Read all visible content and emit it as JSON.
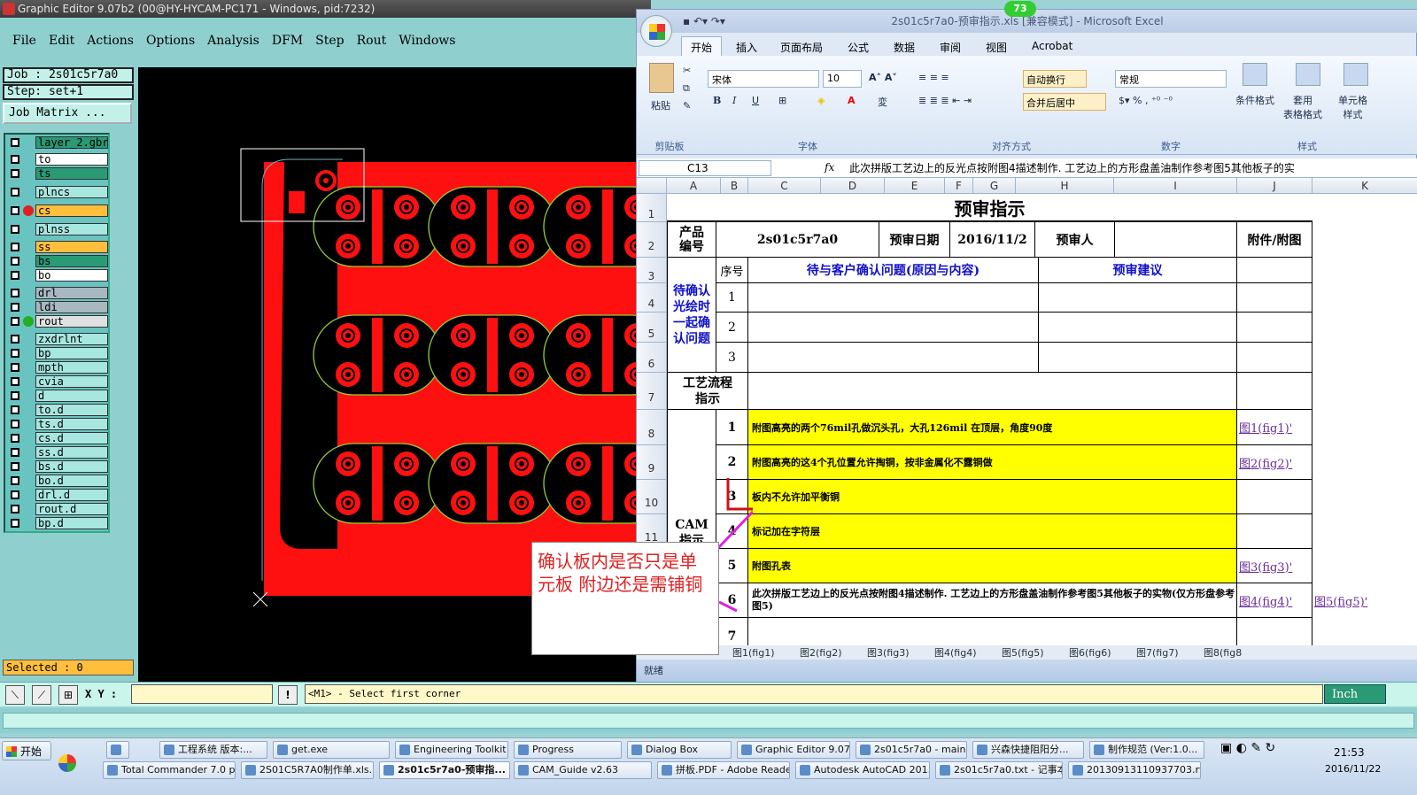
{
  "graphic_editor": {
    "title": "Graphic Editor 9.07b2 (00@HY-HYCAM-PC171 - Windows, pid:7232)",
    "menu": [
      "File",
      "Edit",
      "Actions",
      "Options",
      "Analysis",
      "DFM",
      "Step",
      "Rout",
      "Windows"
    ],
    "job": "Job : 2s01c5r7a0",
    "step": "Step: set+1",
    "job_matrix": "Job Matrix ...",
    "layers": [
      {
        "name": "layer_2.gbr",
        "color": "#2a9a74",
        "dot": ""
      },
      {
        "name": "to",
        "color": "#ffffff",
        "dot": ""
      },
      {
        "name": "ts",
        "color": "#2a9a74",
        "dot": ""
      },
      {
        "name": "plncs",
        "color": "#a8e6e0",
        "dot": ""
      },
      {
        "name": "cs",
        "color": "#ffbf3c",
        "dot": "#e02020"
      },
      {
        "name": "plnss",
        "color": "#a8e6e0",
        "dot": ""
      },
      {
        "name": "ss",
        "color": "#ffbf3c",
        "dot": ""
      },
      {
        "name": "bs",
        "color": "#2a9a74",
        "dot": ""
      },
      {
        "name": "bo",
        "color": "#ffffff",
        "dot": ""
      },
      {
        "name": "drl",
        "color": "#a8b8c0",
        "dot": ""
      },
      {
        "name": "ldi",
        "color": "#a8b8c0",
        "dot": ""
      },
      {
        "name": "rout",
        "color": "#e0e0e0",
        "dot": "#20b020"
      },
      {
        "name": "zxdrlnt",
        "color": "#a8e6e0",
        "dot": ""
      },
      {
        "name": "bp",
        "color": "#a8e6e0",
        "dot": ""
      },
      {
        "name": "mpth",
        "color": "#a8e6e0",
        "dot": ""
      },
      {
        "name": "cvia",
        "color": "#a8e6e0",
        "dot": ""
      },
      {
        "name": "d",
        "color": "#a8e6e0",
        "dot": ""
      },
      {
        "name": "to.d",
        "color": "#a8e6e0",
        "dot": ""
      },
      {
        "name": "ts.d",
        "color": "#a8e6e0",
        "dot": ""
      },
      {
        "name": "cs.d",
        "color": "#a8e6e0",
        "dot": ""
      },
      {
        "name": "ss.d",
        "color": "#a8e6e0",
        "dot": ""
      },
      {
        "name": "bs.d",
        "color": "#a8e6e0",
        "dot": ""
      },
      {
        "name": "bo.d",
        "color": "#a8e6e0",
        "dot": ""
      },
      {
        "name": "drl.d",
        "color": "#a8e6e0",
        "dot": ""
      },
      {
        "name": "rout.d",
        "color": "#a8e6e0",
        "dot": ""
      },
      {
        "name": "bp.d",
        "color": "#a8e6e0",
        "dot": ""
      }
    ],
    "selected": "Selected : 0",
    "xy_label": "X Y :",
    "prompt": "<M1> - Select first corner",
    "units": "Inch"
  },
  "excel": {
    "badge": "73",
    "title": "2s01c5r7a0-预审指示.xls  [兼容模式] - Microsoft Excel",
    "tabs": [
      "开始",
      "插入",
      "页面布局",
      "公式",
      "数据",
      "审阅",
      "视图",
      "Acrobat"
    ],
    "ribbon": {
      "paste": "粘贴",
      "clipboard": "剪贴板",
      "font_name": "宋体",
      "font_size": "10",
      "font": "字体",
      "wrap": "自动换行",
      "merge": "合并后居中",
      "alignment": "对齐方式",
      "number_format": "常规",
      "number": "数字",
      "cond_format": "条件格式",
      "table_format": "套用\n表格格式",
      "cell_style": "单元格\n样式",
      "styles": "样式"
    },
    "name_box": "C13",
    "formula": "此次拼版工艺边上的反光点按附图4描述制作. 工艺边上的方形盘盖油制作参考图5其他板子的实",
    "columns": [
      "A",
      "B",
      "C",
      "D",
      "E",
      "F",
      "G",
      "H",
      "I",
      "J",
      "K"
    ],
    "rows": [
      "1",
      "2",
      "3",
      "4",
      "5",
      "6",
      "7",
      "8",
      "9",
      "10",
      "11",
      "5",
      "6",
      "7"
    ],
    "sheet": {
      "title": "预审指示",
      "product_label": "产品\n编号",
      "product_no": "2s01c5r7a0",
      "date_label": "预审日期",
      "date": "2016/11/2",
      "reviewer_label": "预审人",
      "attach_label": "附件/附图",
      "seq": "序号",
      "issue_hdr": "待与客户确认问题(原因与内容)",
      "advice_hdr": "预审建议",
      "pending": "待确认\n光绘时\n一起确\n认问题",
      "q1": "1",
      "q2": "2",
      "q3": "3",
      "process": "工艺流程\n指示",
      "cam": "CAM\n指示",
      "items": [
        {
          "n": "1",
          "text": "附图高亮的两个76mil孔做沉头孔，大孔126mil 在顶层，角度90度",
          "link": "图1(fig1)'",
          "link2": ""
        },
        {
          "n": "2",
          "text": "附图高亮的这4个孔位置允许掏铜，按非金属化不露铜做",
          "link": "图2(fig2)'",
          "link2": ""
        },
        {
          "n": "3",
          "text": "板内不允许加平衡铜",
          "link": "",
          "link2": ""
        },
        {
          "n": "4",
          "text": "标记加在字符层",
          "link": "",
          "link2": ""
        },
        {
          "n": "5",
          "text": "附图孔表",
          "link": "图3(fig3)'",
          "link2": ""
        },
        {
          "n": "6",
          "text": "此次拼版工艺边上的反光点按附图4描述制作. 工艺边上的方形盘盖油制作参考图5其他板子的实物(仅方形盘参考图5)",
          "link": "图4(fig4)'",
          "link2": "图5(fig5)'"
        },
        {
          "n": "7",
          "text": "",
          "link": "",
          "link2": ""
        }
      ]
    },
    "sheet_tabs": [
      "图1(fig1)",
      "图2(fig2)",
      "图3(fig3)",
      "图4(fig4)",
      "图5(fig5)",
      "图6(fig6)",
      "图7(fig7)",
      "图8(fig8"
    ],
    "status": "就绪"
  },
  "callout": "确认板内是否只是单元板  附边还是需铺铜",
  "taskbar": {
    "start": "开始",
    "row1": [
      "",
      "工程系统  版本:...",
      "get.exe",
      "Engineering Toolkit ...",
      "Progress",
      "Dialog Box",
      "Graphic Editor 9.07...",
      "2s01c5r7a0 - main...",
      "兴森快捷阻阳分...",
      "制作规范 (Ver:1.0..."
    ],
    "row2": [
      "Total Commander 7.0 pu...",
      "2S01C5R7A0制作单.xls...",
      "2s01c5r7a0-预审指...",
      "CAM_Guide v2.63",
      "拼板.PDF - Adobe Reader",
      "Autodesk AutoCAD 201...",
      "2s01c5r7a0.txt - 记事本",
      "20130913110937703.rt..."
    ],
    "time": "21:53",
    "date": "2016/11/22"
  }
}
